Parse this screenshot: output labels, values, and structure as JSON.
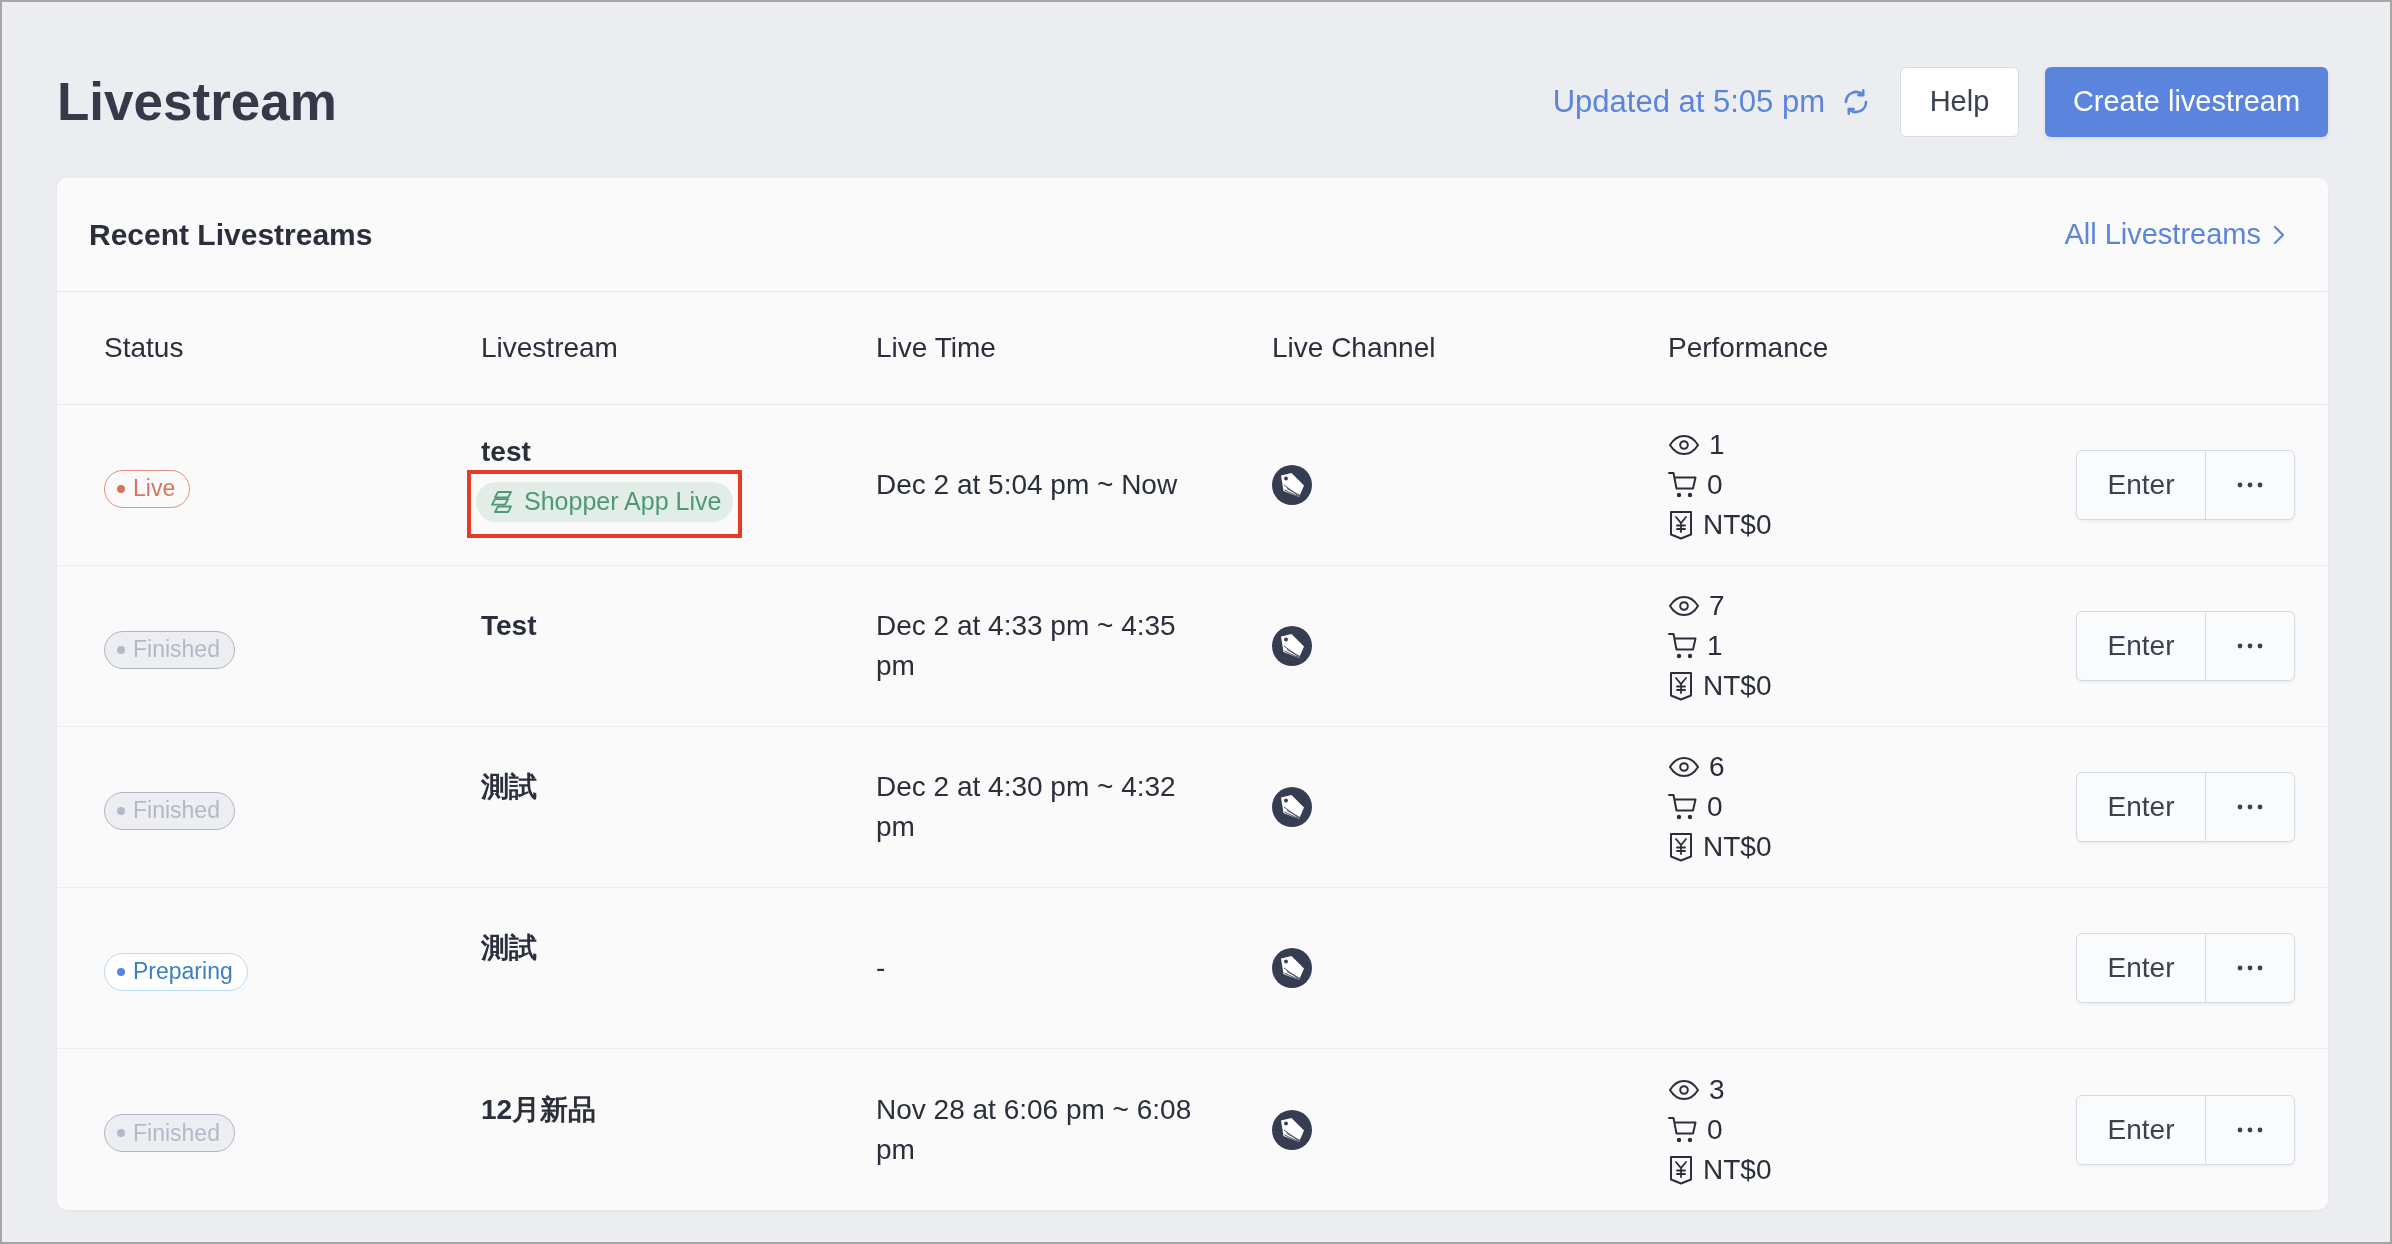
{
  "page": {
    "title": "Livestream",
    "updated": "Updated at 5:05 pm",
    "buttons": [
      {
        "label": "Help",
        "kind": "secondary"
      },
      {
        "label": "Create livestream",
        "kind": "primary"
      }
    ]
  },
  "card": {
    "title": "Recent Livestreams",
    "link": "All Livestreams"
  },
  "table": {
    "columns": [
      "Status",
      "Livestream",
      "Live Time",
      "Live Channel",
      "Performance"
    ],
    "rows": [
      {
        "status": {
          "label": "Live",
          "kind": "live"
        },
        "name": "test",
        "tags": [
          {
            "label": "Shopper App Live",
            "highlighted": true
          }
        ],
        "live_time": "Dec 2 at 5:04 pm ~ Now",
        "performance": [
          {
            "kind": "views",
            "value": "1"
          },
          {
            "kind": "orders",
            "value": "0"
          },
          {
            "kind": "revenue",
            "value": "NT$0"
          }
        ],
        "action": "Enter"
      },
      {
        "status": {
          "label": "Finished",
          "kind": "finished"
        },
        "name": "Test",
        "live_time": "Dec 2 at 4:33 pm ~ 4:35 pm",
        "performance": [
          {
            "kind": "views",
            "value": "7"
          },
          {
            "kind": "orders",
            "value": "1"
          },
          {
            "kind": "revenue",
            "value": "NT$0"
          }
        ],
        "action": "Enter"
      },
      {
        "status": {
          "label": "Finished",
          "kind": "finished"
        },
        "name": "測試",
        "live_time": "Dec 2 at 4:30 pm ~ 4:32 pm",
        "performance": [
          {
            "kind": "views",
            "value": "6"
          },
          {
            "kind": "orders",
            "value": "0"
          },
          {
            "kind": "revenue",
            "value": "NT$0"
          }
        ],
        "action": "Enter"
      },
      {
        "status": {
          "label": "Preparing",
          "kind": "preparing"
        },
        "name": "測試",
        "live_time": "-",
        "action": "Enter"
      },
      {
        "status": {
          "label": "Finished",
          "kind": "finished"
        },
        "name": "12月新品",
        "live_time": "Nov 28 at 6:06 pm ~ 6:08 pm",
        "performance": [
          {
            "kind": "views",
            "value": "3"
          },
          {
            "kind": "orders",
            "value": "0"
          },
          {
            "kind": "revenue",
            "value": "NT$0"
          }
        ],
        "action": "Enter"
      }
    ]
  }
}
